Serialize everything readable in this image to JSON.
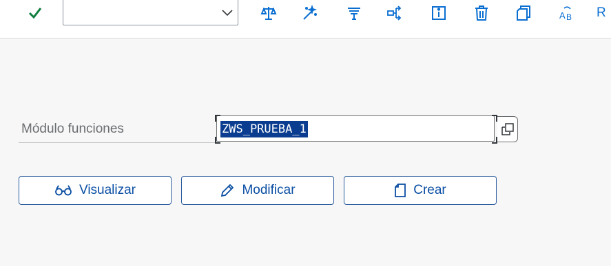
{
  "toolbar": {
    "command_field": {
      "value": "",
      "placeholder": ""
    },
    "icons": [
      "check-icon",
      "dropdown-chevron-icon",
      "balance-scale-icon",
      "magic-wand-icon",
      "filter-stack-icon",
      "where-used-icon",
      "info-icon",
      "delete-icon",
      "copy-icon",
      "rename-icon",
      "more-icon"
    ],
    "cut_off_label": "R"
  },
  "form": {
    "field_label": "Módulo funciones",
    "field_value": "ZWS_PRUEBA_1"
  },
  "buttons": {
    "display_label": "Visualizar",
    "change_label": "Modificar",
    "create_label": "Crear"
  },
  "colors": {
    "accent": "#0a6ed1",
    "button_text": "#0a4ea3",
    "check": "#107e3e",
    "selection": "#0a3d8f",
    "background": "#f7f7f7"
  }
}
